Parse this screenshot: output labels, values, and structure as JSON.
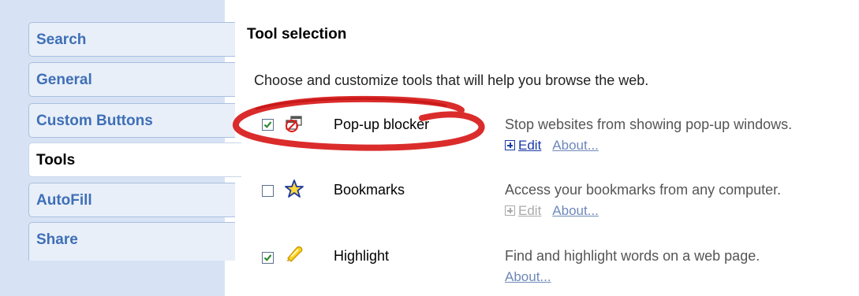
{
  "sidebar": {
    "items": [
      {
        "label": "Search",
        "active": false
      },
      {
        "label": "General",
        "active": false
      },
      {
        "label": "Custom Buttons",
        "active": false
      },
      {
        "label": "Tools",
        "active": true
      },
      {
        "label": "AutoFill",
        "active": false
      },
      {
        "label": "Share",
        "active": false
      }
    ]
  },
  "main": {
    "title": "Tool selection",
    "intro": "Choose and customize tools that will help you browse the web.",
    "tools": [
      {
        "name": "Pop-up blocker",
        "description": "Stop websites from showing pop-up windows.",
        "checked": true,
        "icon": "popup-blocker-icon",
        "edit_label": "Edit",
        "edit_enabled": true,
        "about_label": "About..."
      },
      {
        "name": "Bookmarks",
        "description": "Access your bookmarks from any computer.",
        "checked": false,
        "icon": "star-icon",
        "edit_label": "Edit",
        "edit_enabled": false,
        "about_label": "About..."
      },
      {
        "name": "Highlight",
        "description": "Find and highlight words on a web page.",
        "checked": true,
        "icon": "highlighter-icon",
        "about_label": "About..."
      }
    ]
  },
  "colors": {
    "sidebar_bg": "#d7e3f5",
    "tab_text": "#3f6fb6",
    "link": "#1a3aa8",
    "about_link": "#6e88b9",
    "annotation": "#d81a1a",
    "checkmark": "#2e8b2e"
  }
}
